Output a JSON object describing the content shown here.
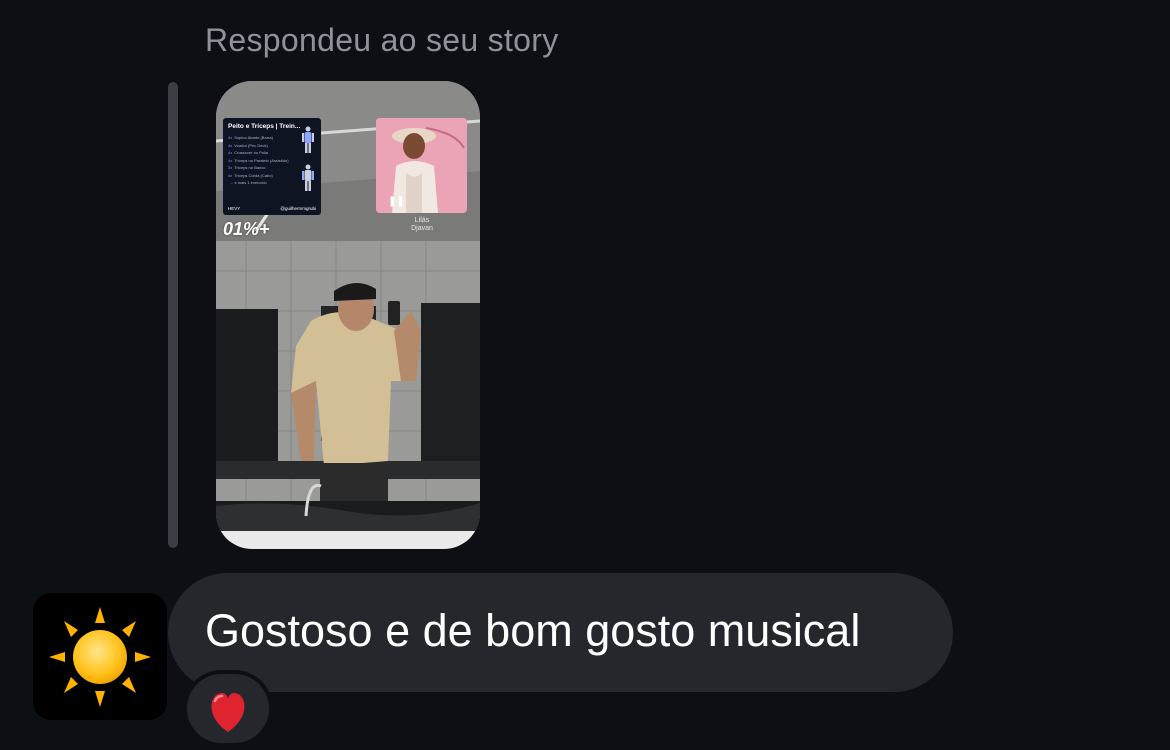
{
  "thread": {
    "reply_header": "Respondeu ao seu story"
  },
  "story": {
    "workout_sticker": {
      "title": "Peito e Tríceps | Trein...",
      "exercises": [
        {
          "sets": "4x",
          "name": "Supino Abarto (Barra)"
        },
        {
          "sets": "4x",
          "name": "Voador (Pec Deck)"
        },
        {
          "sets": "4x",
          "name": "Crossover no Polia"
        },
        {
          "sets": "4x",
          "name": "Tríceps no Paralelo (Assistido)"
        },
        {
          "sets": "3x",
          "name": "Tríceps no Banco"
        },
        {
          "sets": "4x",
          "name": "Tríceps Corda (Cabo)"
        },
        {
          "sets": "",
          "name": "... e mais 1 exercício"
        }
      ],
      "brand": "HEVY",
      "handle": "@guilhermmgrubi"
    },
    "percent_label": "01%+",
    "music": {
      "song": "Lilás",
      "artist": "Djavan"
    }
  },
  "message": {
    "text": "Gostoso e de bom gosto musical",
    "reaction": "❤️",
    "avatar_emoji": "☀️"
  },
  "colors": {
    "background": "#0c0f14",
    "bubble": "#25272c",
    "header_text": "#8e939b",
    "quote_bar": "#3b3e45"
  }
}
